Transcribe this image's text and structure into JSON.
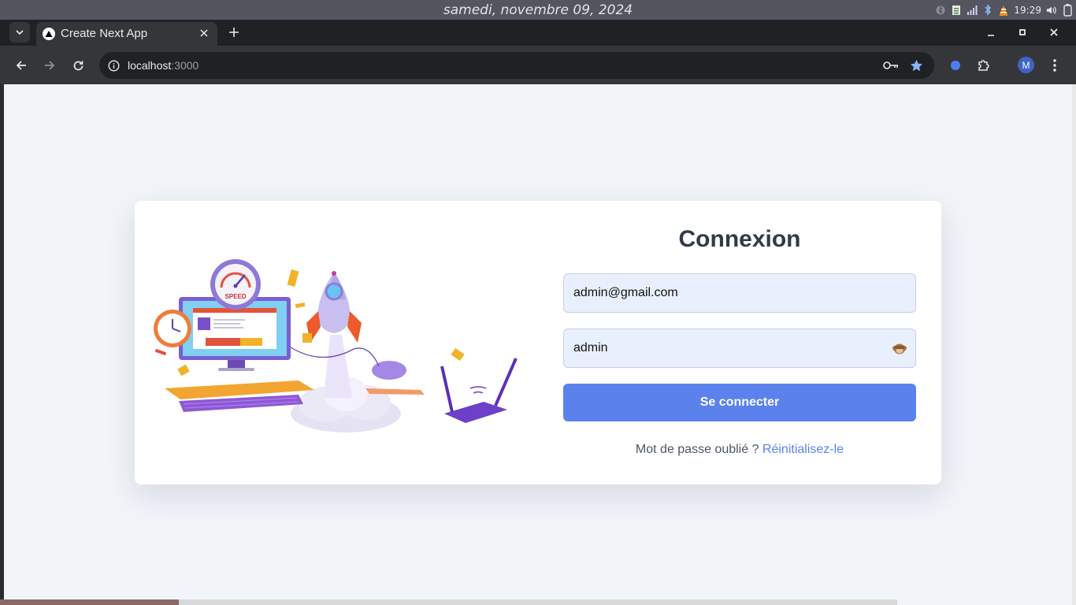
{
  "os": {
    "date": "samedi, novembre 09, 2024",
    "time": "19:29",
    "tray_icons": [
      "bluetooth-small-icon",
      "clipboard-icon",
      "network-icon",
      "bluetooth-icon",
      "vlc-icon",
      "volume-icon",
      "battery-icon"
    ]
  },
  "browser": {
    "tab_title": "Create Next App",
    "url_host": "localhost",
    "url_port": ":3000",
    "profile_initial": "M",
    "accent": "#8ab4f8"
  },
  "login": {
    "title": "Connexion",
    "email_value": "admin@gmail.com",
    "password_value": "admin",
    "password_toggle_icon": "monkey-icon",
    "submit_label": "Se connecter",
    "forgot_text": "Mot de passe oublié ?",
    "reset_link": "Réinitialisez-le",
    "primary_color": "#5b82ec"
  },
  "illustration": {
    "speed_label": "SPEED"
  }
}
